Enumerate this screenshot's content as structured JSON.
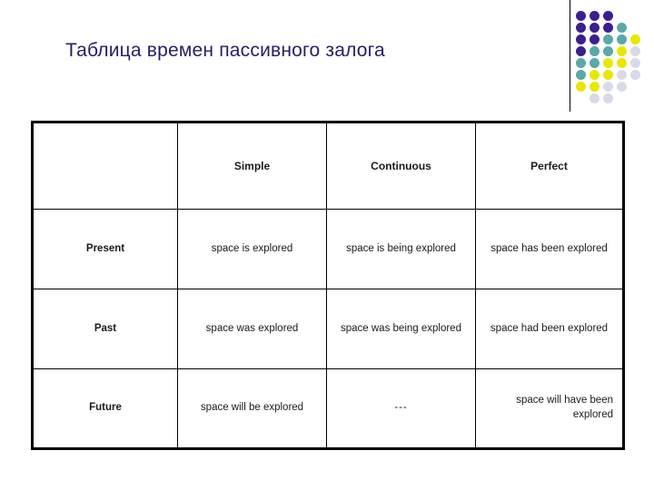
{
  "slide": {
    "title": "Таблица времен пассивного залога",
    "title_color": "#2b1b66"
  },
  "decoration": {
    "rule_color": "#000000",
    "dot_palette": {
      "purple": "#3b1f8f",
      "teal": "#5aa8a8",
      "yellow": "#e8e800",
      "light": "#d8dae8"
    },
    "dots": [
      {
        "row": 0,
        "col": 0,
        "color": "#3b1f8f"
      },
      {
        "row": 0,
        "col": 1,
        "color": "#3b1f8f"
      },
      {
        "row": 0,
        "col": 2,
        "color": "#3b1f8f"
      },
      {
        "row": 1,
        "col": 0,
        "color": "#3b1f8f"
      },
      {
        "row": 1,
        "col": 1,
        "color": "#3b1f8f"
      },
      {
        "row": 1,
        "col": 2,
        "color": "#3b1f8f"
      },
      {
        "row": 1,
        "col": 3,
        "color": "#5aa8a8"
      },
      {
        "row": 2,
        "col": 0,
        "color": "#3b1f8f"
      },
      {
        "row": 2,
        "col": 1,
        "color": "#3b1f8f"
      },
      {
        "row": 2,
        "col": 2,
        "color": "#5aa8a8"
      },
      {
        "row": 2,
        "col": 3,
        "color": "#5aa8a8"
      },
      {
        "row": 2,
        "col": 4,
        "color": "#e8e800"
      },
      {
        "row": 3,
        "col": 0,
        "color": "#3b1f8f"
      },
      {
        "row": 3,
        "col": 1,
        "color": "#5aa8a8"
      },
      {
        "row": 3,
        "col": 2,
        "color": "#5aa8a8"
      },
      {
        "row": 3,
        "col": 3,
        "color": "#e8e800"
      },
      {
        "row": 3,
        "col": 4,
        "color": "#d8dae8"
      },
      {
        "row": 4,
        "col": 0,
        "color": "#5aa8a8"
      },
      {
        "row": 4,
        "col": 1,
        "color": "#5aa8a8"
      },
      {
        "row": 4,
        "col": 2,
        "color": "#e8e800"
      },
      {
        "row": 4,
        "col": 3,
        "color": "#e8e800"
      },
      {
        "row": 4,
        "col": 4,
        "color": "#d8dae8"
      },
      {
        "row": 5,
        "col": 0,
        "color": "#5aa8a8"
      },
      {
        "row": 5,
        "col": 1,
        "color": "#e8e800"
      },
      {
        "row": 5,
        "col": 2,
        "color": "#e8e800"
      },
      {
        "row": 5,
        "col": 3,
        "color": "#d8dae8"
      },
      {
        "row": 5,
        "col": 4,
        "color": "#d8dae8"
      },
      {
        "row": 6,
        "col": 0,
        "color": "#e8e800"
      },
      {
        "row": 6,
        "col": 1,
        "color": "#e8e800"
      },
      {
        "row": 6,
        "col": 2,
        "color": "#d8dae8"
      },
      {
        "row": 6,
        "col": 3,
        "color": "#d8dae8"
      },
      {
        "row": 7,
        "col": 1,
        "color": "#d8dae8"
      },
      {
        "row": 7,
        "col": 2,
        "color": "#d8dae8"
      }
    ]
  },
  "table": {
    "corner_label": "",
    "column_headers": [
      "Simple",
      "Continuous",
      "Perfect"
    ],
    "rows": [
      {
        "label": "Present",
        "cells": [
          "space is explored",
          "space is being explored",
          "space has been explored"
        ]
      },
      {
        "label": "Past",
        "cells": [
          "space was explored",
          "space was being explored",
          "space had been explored"
        ]
      },
      {
        "label": "Future",
        "cells": [
          "space will be explored",
          "---",
          "space will have been explored"
        ]
      }
    ]
  }
}
